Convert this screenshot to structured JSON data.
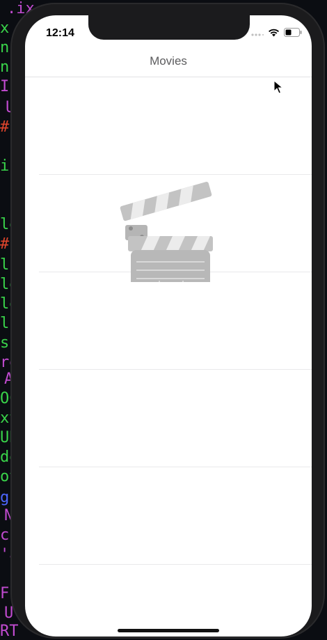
{
  "status_bar": {
    "time": "12:14"
  },
  "nav": {
    "title": "Movies"
  },
  "table": {
    "rows": 6
  },
  "placeholder": {
    "icon": "clapperboard-icon"
  },
  "colors": {
    "accent": "#c8c8c8",
    "title": "#5c5c5e"
  }
}
